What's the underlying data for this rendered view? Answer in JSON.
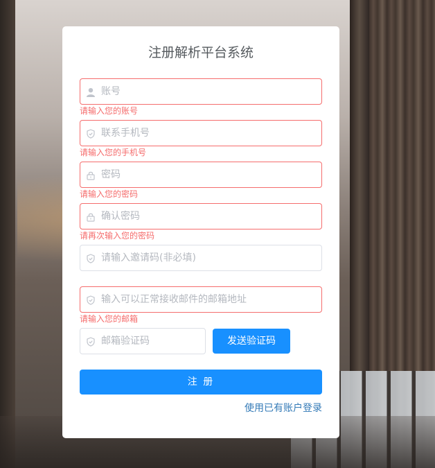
{
  "title": "注册解析平台系统",
  "fields": {
    "account": {
      "placeholder": "账号",
      "error": "请输入您的账号"
    },
    "phone": {
      "placeholder": "联系手机号",
      "error": "请输入您的手机号"
    },
    "password": {
      "placeholder": "密码",
      "error": "请输入您的密码"
    },
    "confirm": {
      "placeholder": "确认密码",
      "error": "请再次输入您的密码"
    },
    "invite": {
      "placeholder": "请输入邀请码(非必填)"
    },
    "email": {
      "placeholder": "输入可以正常接收邮件的邮箱地址",
      "error": "请输入您的邮箱"
    },
    "email_code": {
      "placeholder": "邮箱验证码"
    }
  },
  "send_code_label": "发送验证码",
  "submit_label": "注 册",
  "login_link": "使用已有账户登录",
  "colors": {
    "primary": "#1890ff",
    "error": "#f56c6c",
    "link": "#337ab7"
  },
  "icons": {
    "account": "user-icon",
    "phone": "shield-icon",
    "password": "lock-icon",
    "confirm": "lock-icon",
    "invite": "shield-icon",
    "email": "shield-icon",
    "email_code": "shield-icon"
  }
}
